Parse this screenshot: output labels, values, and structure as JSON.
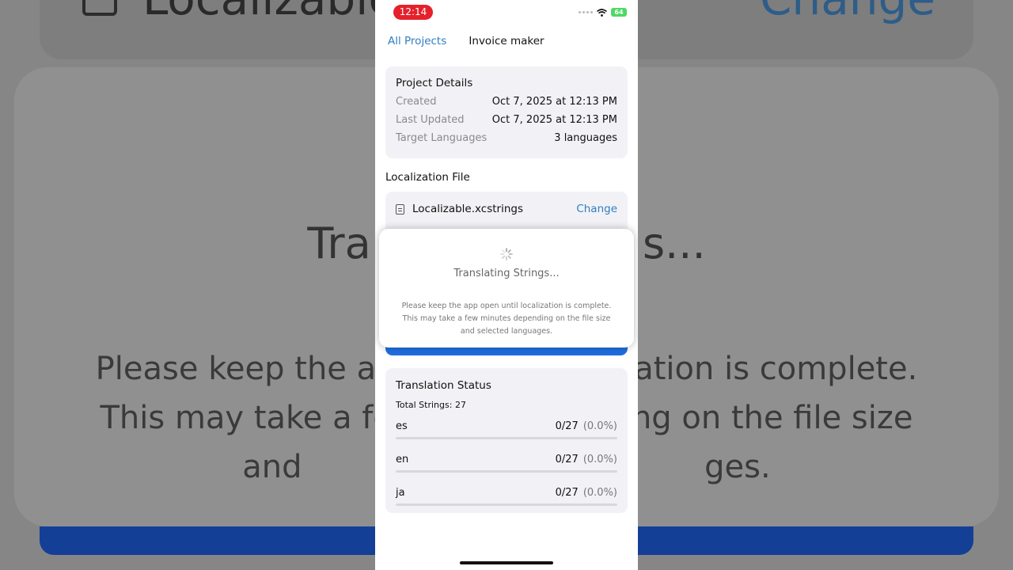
{
  "status_bar": {
    "time": "12:14",
    "battery": "64"
  },
  "nav": {
    "back_label": "All Projects",
    "title": "Invoice maker"
  },
  "project_details": {
    "title": "Project Details",
    "rows": [
      {
        "label": "Created",
        "value": "Oct 7, 2025 at 12:13 PM"
      },
      {
        "label": "Last Updated",
        "value": "Oct 7, 2025 at 12:13 PM"
      },
      {
        "label": "Target Languages",
        "value": "3 languages"
      }
    ]
  },
  "localization_file": {
    "section_label": "Localization File",
    "file_name": "Localizable.xcstrings",
    "change_label": "Change"
  },
  "modal": {
    "title": "Translating Strings...",
    "message": "Please keep the app open until localization is complete. This may take a few minutes depending on the file size and selected languages."
  },
  "translation_status": {
    "title": "Translation Status",
    "total_strings": "Total Strings: 27",
    "languages": [
      {
        "code": "es",
        "count": "0/27",
        "percent": "(0.0%)",
        "progress": 0
      },
      {
        "code": "en",
        "count": "0/27",
        "percent": "(0.0%)",
        "progress": 0
      },
      {
        "code": "ja",
        "count": "0/27",
        "percent": "(0.0%)",
        "progress": 0
      }
    ]
  },
  "background": {
    "file_name": "Localizable.x",
    "change_label": "Change",
    "title": "Tra                    s...",
    "lines": [
      "Please keep the ap                      zation is complete.",
      "This may take a fe                      ling on the file size",
      "and                                        ges."
    ]
  },
  "colors": {
    "accent": "#2f7ec2",
    "primary_button": "#1f6de0",
    "status_time_bg": "#e5212b",
    "battery": "#4cd964"
  },
  "icons": {
    "file": "document-icon",
    "wifi": "wifi-icon",
    "spinner": "activity-spinner-icon"
  }
}
